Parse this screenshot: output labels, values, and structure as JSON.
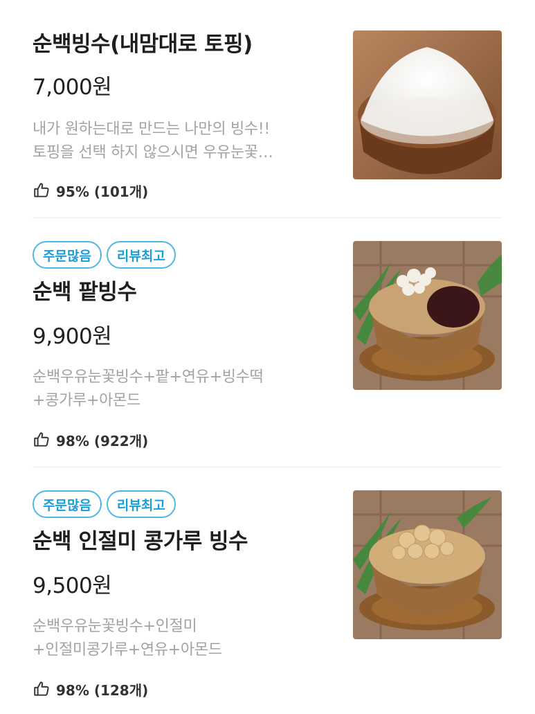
{
  "items": [
    {
      "name": "순백빙수(내맘대로 토핑)",
      "price": "7,000원",
      "desc": [
        "내가 원하는대로 만드는 나만의 빙수!!",
        "토핑을 선택 하지 않으시면 우유눈꽃…"
      ],
      "rating": "95% (101개)",
      "badges": []
    },
    {
      "name": "순백 팥빙수",
      "price": "9,900원",
      "desc": [
        "순백우유눈꽃빙수+팥+연유+빙수떡",
        "+콩가루+아몬드"
      ],
      "rating": "98% (922개)",
      "badges": [
        "주문많음",
        "리뷰최고"
      ]
    },
    {
      "name": "순백 인절미 콩가루 빙수",
      "price": "9,500원",
      "desc": [
        "순백우유눈꽃빙수+인절미",
        "+인절미콩가루+연유+아몬드"
      ],
      "rating": "98% (128개)",
      "badges": [
        "주문많음",
        "리뷰최고"
      ]
    }
  ],
  "icons": {
    "rating": "thumbs-up-icon"
  },
  "colors": {
    "badge_border": "#4fb6e3",
    "badge_text": "#1a9ed9",
    "desc": "#a3a3a3",
    "divider": "#ececec"
  }
}
